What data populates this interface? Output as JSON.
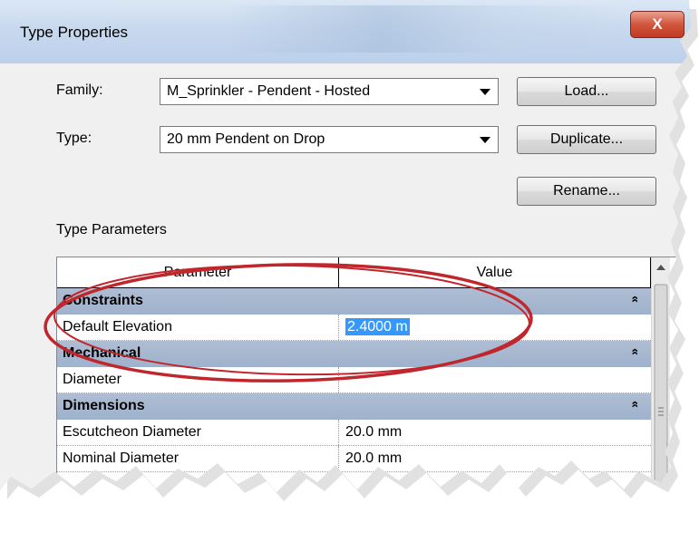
{
  "window": {
    "title": "Type Properties",
    "close_glyph": "X"
  },
  "family": {
    "label": "Family:",
    "value": "M_Sprinkler - Pendent - Hosted"
  },
  "type": {
    "label": "Type:",
    "value": "20 mm Pendent on Drop"
  },
  "buttons": {
    "load": "Load...",
    "duplicate": "Duplicate...",
    "rename": "Rename..."
  },
  "type_parameters": {
    "label": "Type Parameters",
    "header": {
      "parameter": "Parameter",
      "value": "Value"
    },
    "categories": [
      {
        "name": "Constraints",
        "rows": [
          {
            "parameter": "Default Elevation",
            "value": "2.4000 m"
          }
        ]
      },
      {
        "name": "Mechanical",
        "rows": [
          {
            "parameter": "Diameter",
            "value": ""
          }
        ]
      },
      {
        "name": "Dimensions",
        "rows": [
          {
            "parameter": "Escutcheon Diameter",
            "value": "20.0 mm"
          },
          {
            "parameter": "Nominal Diameter",
            "value": "20.0 mm"
          }
        ]
      }
    ],
    "collapse_glyph": "»"
  },
  "colors": {
    "category_bg": "#a4b6cf",
    "highlight_ellipse": "#c0272d",
    "selection": "#3399ff"
  }
}
